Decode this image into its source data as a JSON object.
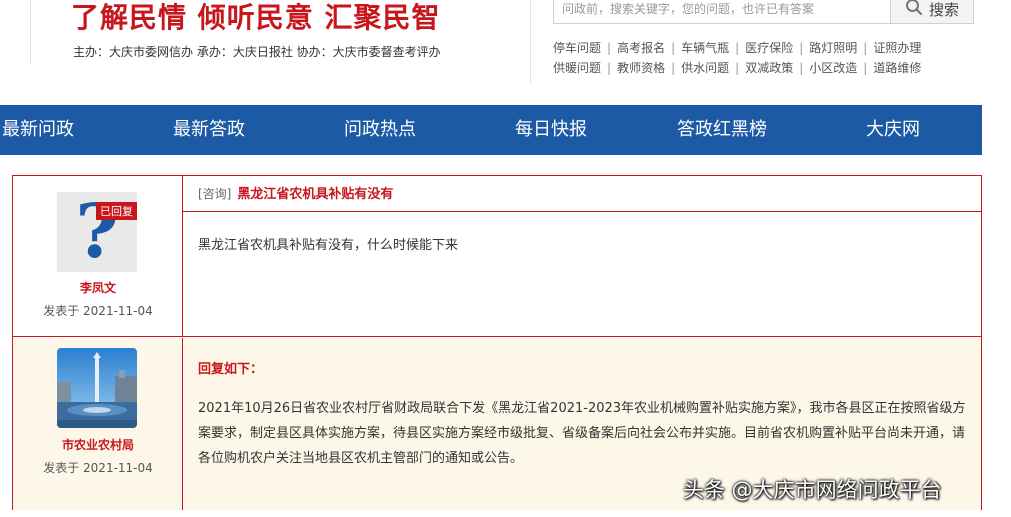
{
  "header": {
    "slogan": "了解民情  倾听民意  汇聚民智",
    "sponsor": "主办：大庆市委网信办   承办：大庆日报社   协办：大庆市委督查考评办",
    "search_placeholder": "问政前，搜索关键字，您的问题，也许已有答案",
    "search_label": "搜索",
    "hot_links_row1": [
      "停车问题",
      "高考报名",
      "车辆气瓶",
      "医疗保险",
      "路灯照明",
      "证照办理"
    ],
    "hot_links_row2": [
      "供暖问题",
      "教师资格",
      "供水问题",
      "双减政策",
      "小区改造",
      "道路维修"
    ]
  },
  "nav": [
    "最新问政",
    "最新答政",
    "问政热点",
    "每日快报",
    "答政红黑榜",
    "大庆网"
  ],
  "question": {
    "badge": "已回复",
    "asker": "李凤文",
    "posted": "发表于  2021-11-04",
    "category": "[咨询]",
    "title": "黑龙江省农机具补贴有没有",
    "body": "黑龙江省农机具补贴有没有，什么时候能下来"
  },
  "reply": {
    "department": "市农业农村局",
    "posted": "发表于  2021-11-04",
    "label": "回复如下：",
    "body": "2021年10月26日省农业农村厅省财政局联合下发《黑龙江省2021-2023年农业机械购置补贴实施方案》，我市各县区正在按照省级方案要求，制定县区具体实施方案，待县区实施方案经市级批复、省级备案后向社会公布并实施。目前省农机购置补贴平台尚未开通，请各位购机农户关注当地县区农机主管部门的通知或公告。"
  },
  "watermark": "头条 @大庆市网络问政平台",
  "colors": {
    "brand_red": "#c8161d",
    "nav_blue": "#1d5aa6",
    "reply_bg": "#fdf7e9"
  },
  "icons": {
    "search": "magnifier-icon",
    "asker_avatar": "question-mark-icon",
    "dept_avatar": "city-square-photo"
  }
}
